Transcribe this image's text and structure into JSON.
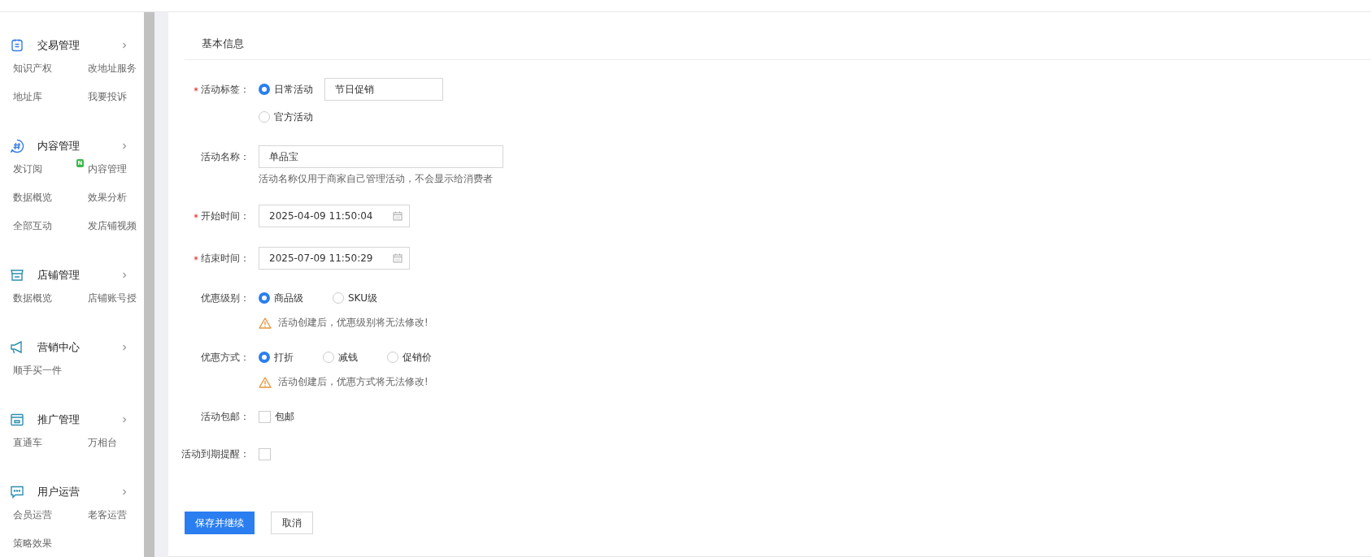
{
  "sidebar": {
    "groups": [
      {
        "title": "交易管理",
        "items": [
          {
            "label": "知识产权"
          },
          {
            "label": "改地址服务"
          },
          {
            "label": "地址库"
          },
          {
            "label": "我要投诉"
          }
        ]
      },
      {
        "title": "内容管理",
        "items": [
          {
            "label": "发订阅"
          },
          {
            "label": "内容管理",
            "badge": "N"
          },
          {
            "label": "数据概览"
          },
          {
            "label": "效果分析"
          },
          {
            "label": "全部互动"
          },
          {
            "label": "发店铺视频"
          }
        ]
      },
      {
        "title": "店铺管理",
        "items": [
          {
            "label": "数据概览"
          },
          {
            "label": "店铺账号授"
          }
        ]
      },
      {
        "title": "营销中心",
        "items": [
          {
            "label": "顺手买一件"
          }
        ]
      },
      {
        "title": "推广管理",
        "items": [
          {
            "label": "直通车"
          },
          {
            "label": "万相台"
          }
        ]
      },
      {
        "title": "用户运营",
        "items": [
          {
            "label": "会员运营"
          },
          {
            "label": "老客运营"
          },
          {
            "label": "策略效果"
          }
        ]
      }
    ]
  },
  "form": {
    "section_title": "基本信息",
    "rows": [
      {
        "kind": "tag",
        "label": "活动标签：",
        "required": true,
        "options": [
          {
            "label": "日常活动",
            "selected": true,
            "value": "节日促销"
          },
          {
            "label": "官方活动",
            "selected": false
          }
        ]
      },
      {
        "kind": "text",
        "label": "活动名称：",
        "required": false,
        "value": "单品宝",
        "hint": "活动名称仅用于商家自己管理活动，不会显示给消费者"
      },
      {
        "kind": "date",
        "label": "开始时间：",
        "required": true,
        "value": "2025-04-09 11:50:04"
      },
      {
        "kind": "date",
        "label": "结束时间：",
        "required": true,
        "value": "2025-07-09 11:50:29"
      },
      {
        "kind": "radio",
        "label": "优惠级别：",
        "required": false,
        "options": [
          {
            "label": "商品级",
            "selected": true
          },
          {
            "label": "SKU级",
            "selected": false
          }
        ],
        "warning": "活动创建后，优惠级别将无法修改!"
      },
      {
        "kind": "radio",
        "label": "优惠方式：",
        "required": false,
        "options": [
          {
            "label": "打折",
            "selected": true
          },
          {
            "label": "减钱",
            "selected": false
          },
          {
            "label": "促销价",
            "selected": false
          }
        ],
        "warning": "活动创建后，优惠方式将无法修改!"
      },
      {
        "kind": "checkbox",
        "label": "活动包邮：",
        "required": false,
        "checked": false,
        "text": "包邮"
      },
      {
        "kind": "checkbox",
        "label": "活动到期提醒：",
        "required": false,
        "checked": false
      }
    ],
    "buttons": [
      {
        "label": "保存并继续",
        "kind": "primary"
      },
      {
        "label": "取消",
        "kind": "default"
      }
    ]
  }
}
